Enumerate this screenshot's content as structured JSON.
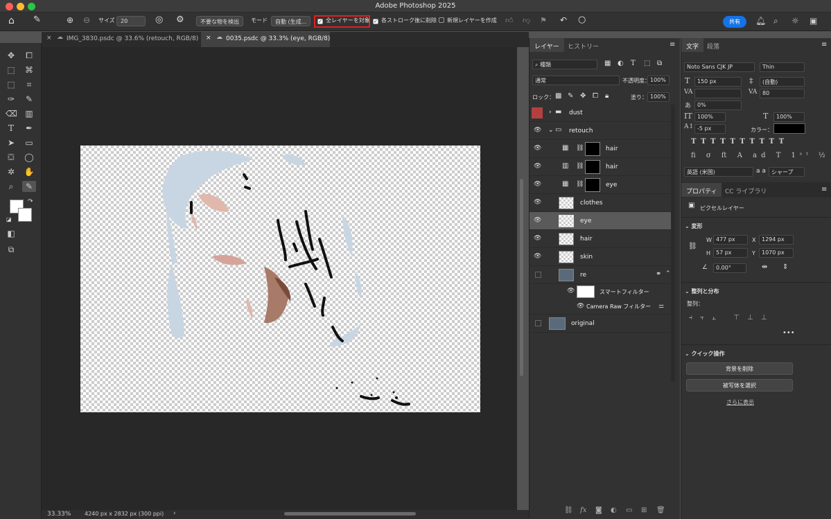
{
  "window": {
    "title": "Adobe Photoshop 2025"
  },
  "options_bar": {
    "size_label": "サイズ",
    "size_value": "20",
    "remove_btn": "不要な物を検出",
    "mode_label": "モード",
    "mode_value": "自動 (生成...",
    "sample_all_layers": "全レイヤーを対象",
    "remove_after_stroke": "各ストローク後に削除",
    "new_layer": "新規レイヤーを作成",
    "share": "共有"
  },
  "tabs": [
    {
      "label": "IMG_3830.psdc @ 33.6% (retouch, RGB/8)"
    },
    {
      "label": "0035.psdc @ 33.3% (eye, RGB/8)"
    }
  ],
  "status": {
    "zoom": "33.33%",
    "info": "4240 px x 2832 px (300 ppi)"
  },
  "layers_panel": {
    "tabs": [
      "レイヤー",
      "ヒストリー"
    ],
    "filter": "種類",
    "blend_mode": "通常",
    "opacity_label": "不透明度：",
    "opacity_value": "100%",
    "lock_label": "ロック：",
    "fill_label": "塗り：",
    "fill_value": "100%",
    "layers": [
      {
        "name": "dust"
      },
      {
        "name": "retouch"
      },
      {
        "name": "hair"
      },
      {
        "name": "hair"
      },
      {
        "name": "eye"
      },
      {
        "name": "clothes"
      },
      {
        "name": "eye"
      },
      {
        "name": "hair"
      },
      {
        "name": "skin"
      },
      {
        "name": "re"
      },
      {
        "name": "スマートフィルター"
      },
      {
        "name": "Camera Raw フィルター"
      },
      {
        "name": "original"
      }
    ]
  },
  "char_panel": {
    "tabs": [
      "文字",
      "段落"
    ],
    "font": "Noto Sans CJK JP",
    "style": "Thin",
    "size": "150 px",
    "leading": "(自動)",
    "tracking": "80",
    "scale_pct": "0%",
    "vscale": "100%",
    "hscale": "100%",
    "baseline": "-5 px",
    "color_label": "カラー：",
    "language": "英語 (米国)",
    "aa_label": "a a",
    "aa_value": "シャープ"
  },
  "props_panel": {
    "tabs": [
      "プロパティ",
      "CC ライブラリ"
    ],
    "kind": "ピクセルレイヤー",
    "transform": "変形",
    "w_label": "W",
    "w": "477 px",
    "h_label": "H",
    "h": "57 px",
    "x_label": "X",
    "x": "1294 px",
    "y_label": "Y",
    "y": "1070 px",
    "angle": "0.00°",
    "align": "整列と分布",
    "align_sub": "整列：",
    "quick": "クイック操作",
    "btn_remove_bg": "背景を削除",
    "btn_select_subject": "被写体を選択",
    "show_more": "さらに表示"
  }
}
